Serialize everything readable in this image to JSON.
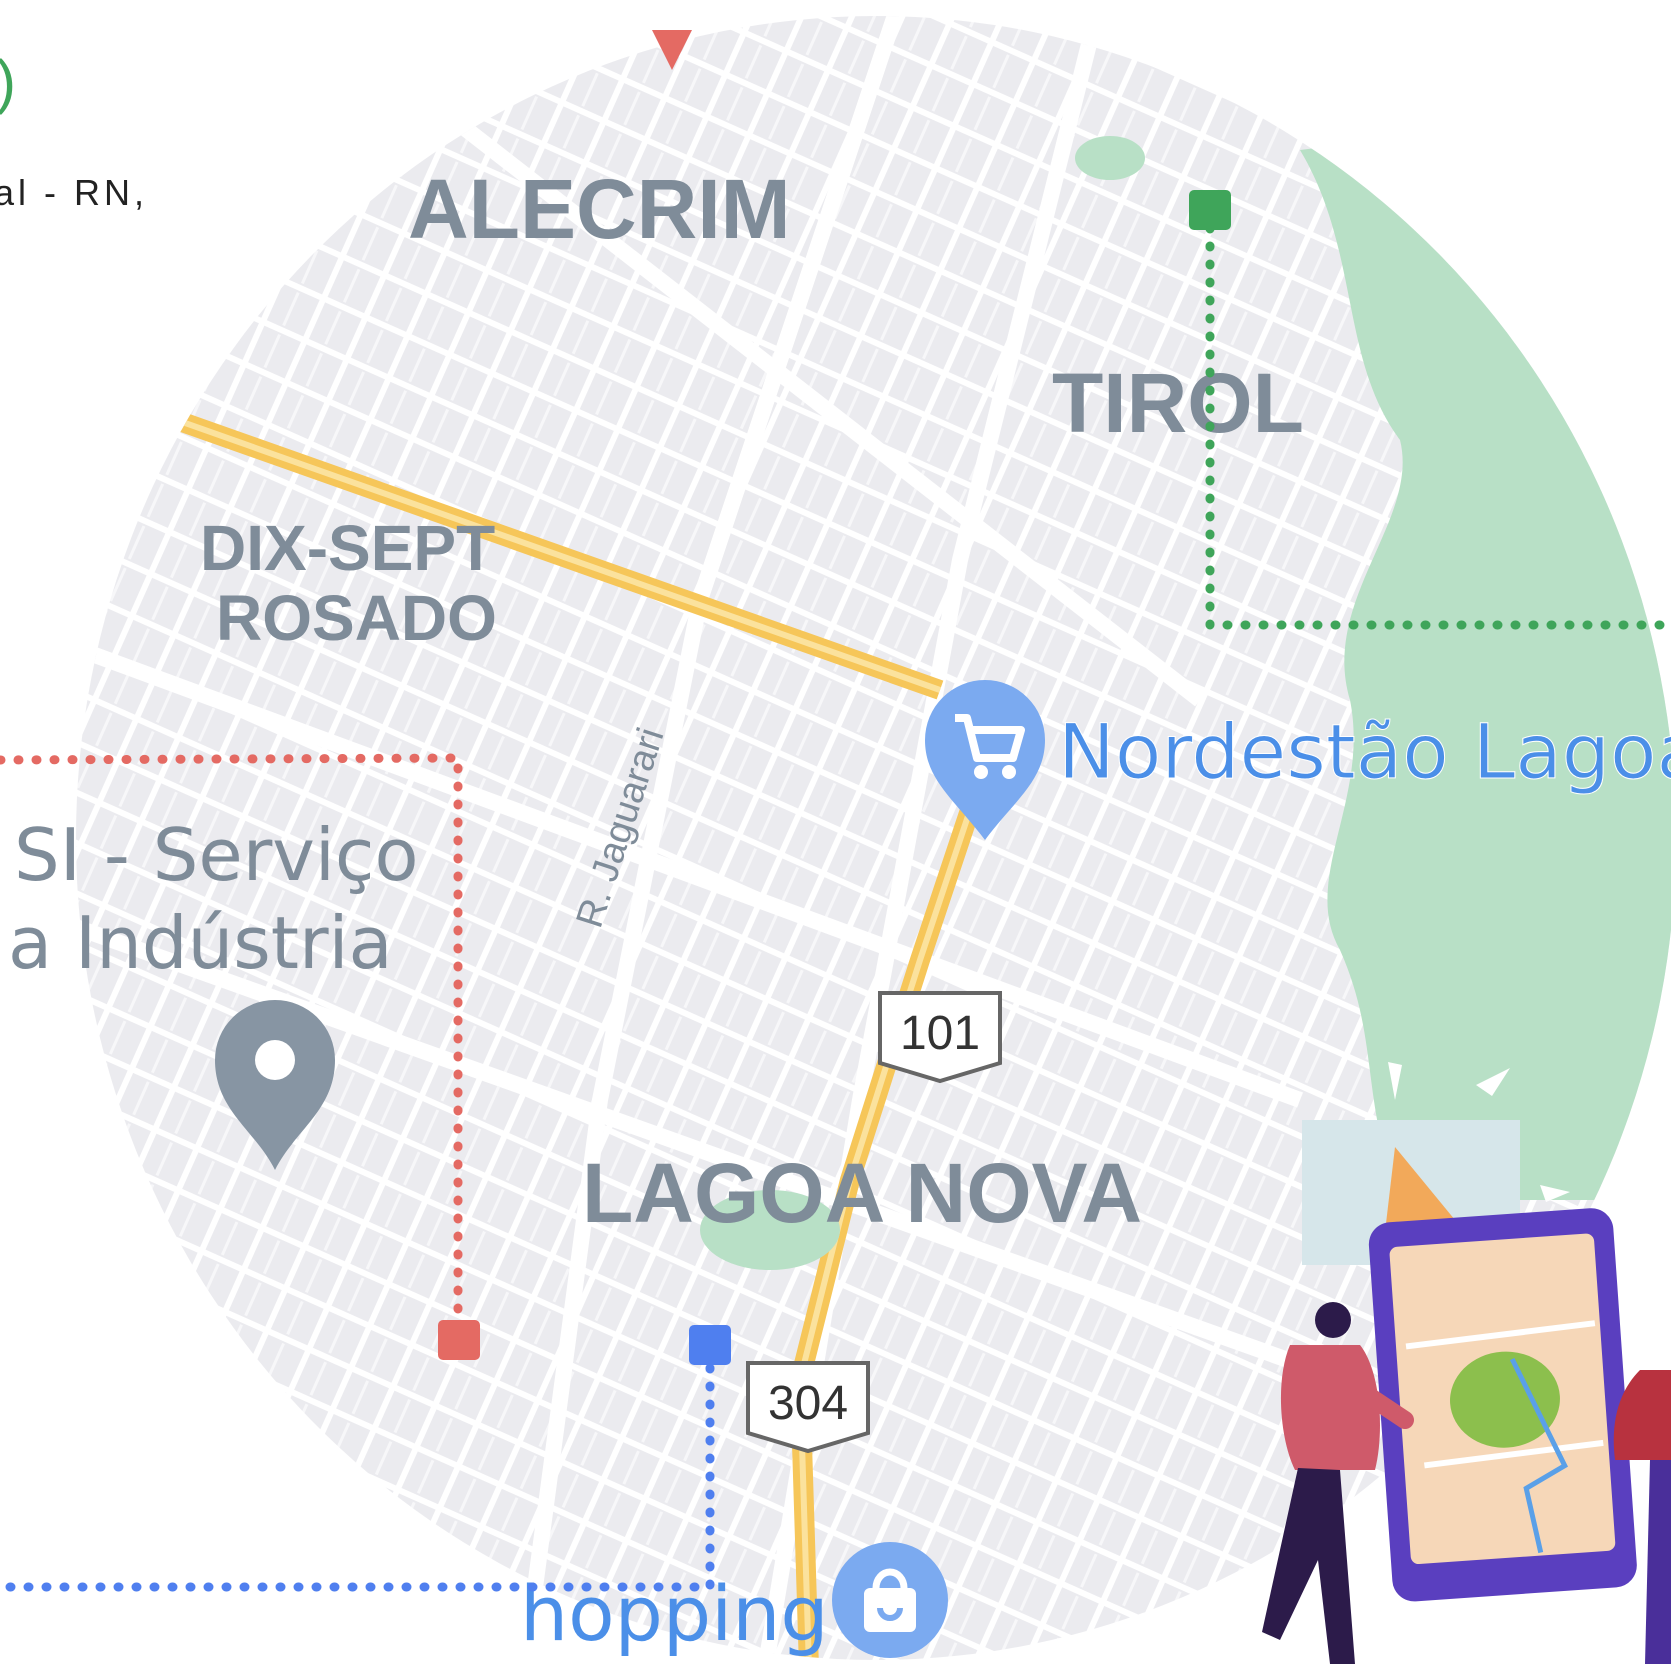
{
  "header": {
    "paren": ")",
    "address_fragment": "al - RN,"
  },
  "map": {
    "districts": {
      "alecrim": "ALECRIM",
      "tirol": "TIROL",
      "dix_sept_line1": "DIX-SEPT",
      "dix_sept_line2": "ROSADO",
      "lagoa_nova": "LAGOA NOVA"
    },
    "street_label": "R. Jaguarari",
    "pois": {
      "nordestao": "Nordestão Lagoa",
      "senai_line1": "SI - Serviço",
      "senai_line2": "a Indústria",
      "shopping": "hopping"
    },
    "shields": {
      "route_101": "101",
      "route_304": "304"
    },
    "colors": {
      "water_green": "#b8e0c6",
      "map_bg": "#ebebef",
      "road": "#ffffff",
      "highway": "#f6c659",
      "label_gray": "#7f8c99",
      "poi_blue": "#4b8fe8",
      "marker_green": "#3fa55a",
      "marker_red": "#e46a63",
      "marker_blue": "#4f7fef"
    }
  }
}
